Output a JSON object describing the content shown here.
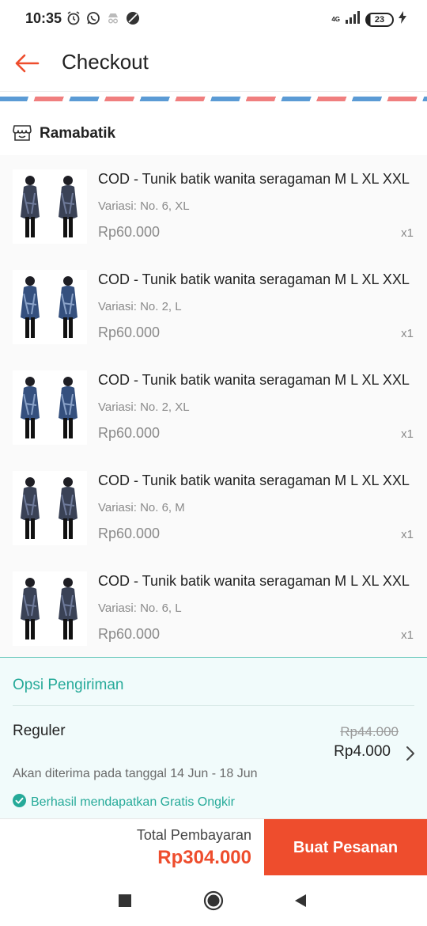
{
  "status_bar": {
    "time": "10:35",
    "network": "4G",
    "battery": "23"
  },
  "header": {
    "title": "Checkout"
  },
  "shop": {
    "name": "Ramabatik"
  },
  "items": [
    {
      "title": "COD - Tunik batik wanita seragaman M L XL XXL",
      "variant": "Variasi: No. 6, XL",
      "price": "Rp60.000",
      "qty": "x1"
    },
    {
      "title": "COD - Tunik batik wanita seragaman M L XL XXL",
      "variant": "Variasi: No. 2, L",
      "price": "Rp60.000",
      "qty": "x1"
    },
    {
      "title": "COD - Tunik batik wanita seragaman M L XL XXL",
      "variant": "Variasi: No. 2, XL",
      "price": "Rp60.000",
      "qty": "x1"
    },
    {
      "title": "COD - Tunik batik wanita seragaman M L XL XXL",
      "variant": "Variasi: No. 6, M",
      "price": "Rp60.000",
      "qty": "x1"
    },
    {
      "title": "COD - Tunik batik wanita seragaman M L XL XXL",
      "variant": "Variasi: No. 6, L",
      "price": "Rp60.000",
      "qty": "x1"
    }
  ],
  "shipping": {
    "title": "Opsi Pengiriman",
    "method": "Reguler",
    "old_price": "Rp44.000",
    "new_price": "Rp4.000",
    "eta": "Akan diterima pada tanggal 14 Jun - 18 Jun",
    "free_shipping": "Berhasil mendapatkan Gratis Ongkir"
  },
  "footer": {
    "total_label": "Total Pembayaran",
    "total_value": "Rp304.000",
    "order_button": "Buat Pesanan"
  },
  "colors": {
    "accent": "#ee4d2d",
    "teal": "#26aa99",
    "shipping_bg": "#f1fbfb"
  },
  "icons": {
    "back": "arrow-left-icon",
    "shop": "store-icon",
    "chevron": "chevron-right-icon",
    "check": "check-circle-icon",
    "nav_recent": "square-icon",
    "nav_home": "circle-icon",
    "nav_back": "triangle-back-icon"
  }
}
